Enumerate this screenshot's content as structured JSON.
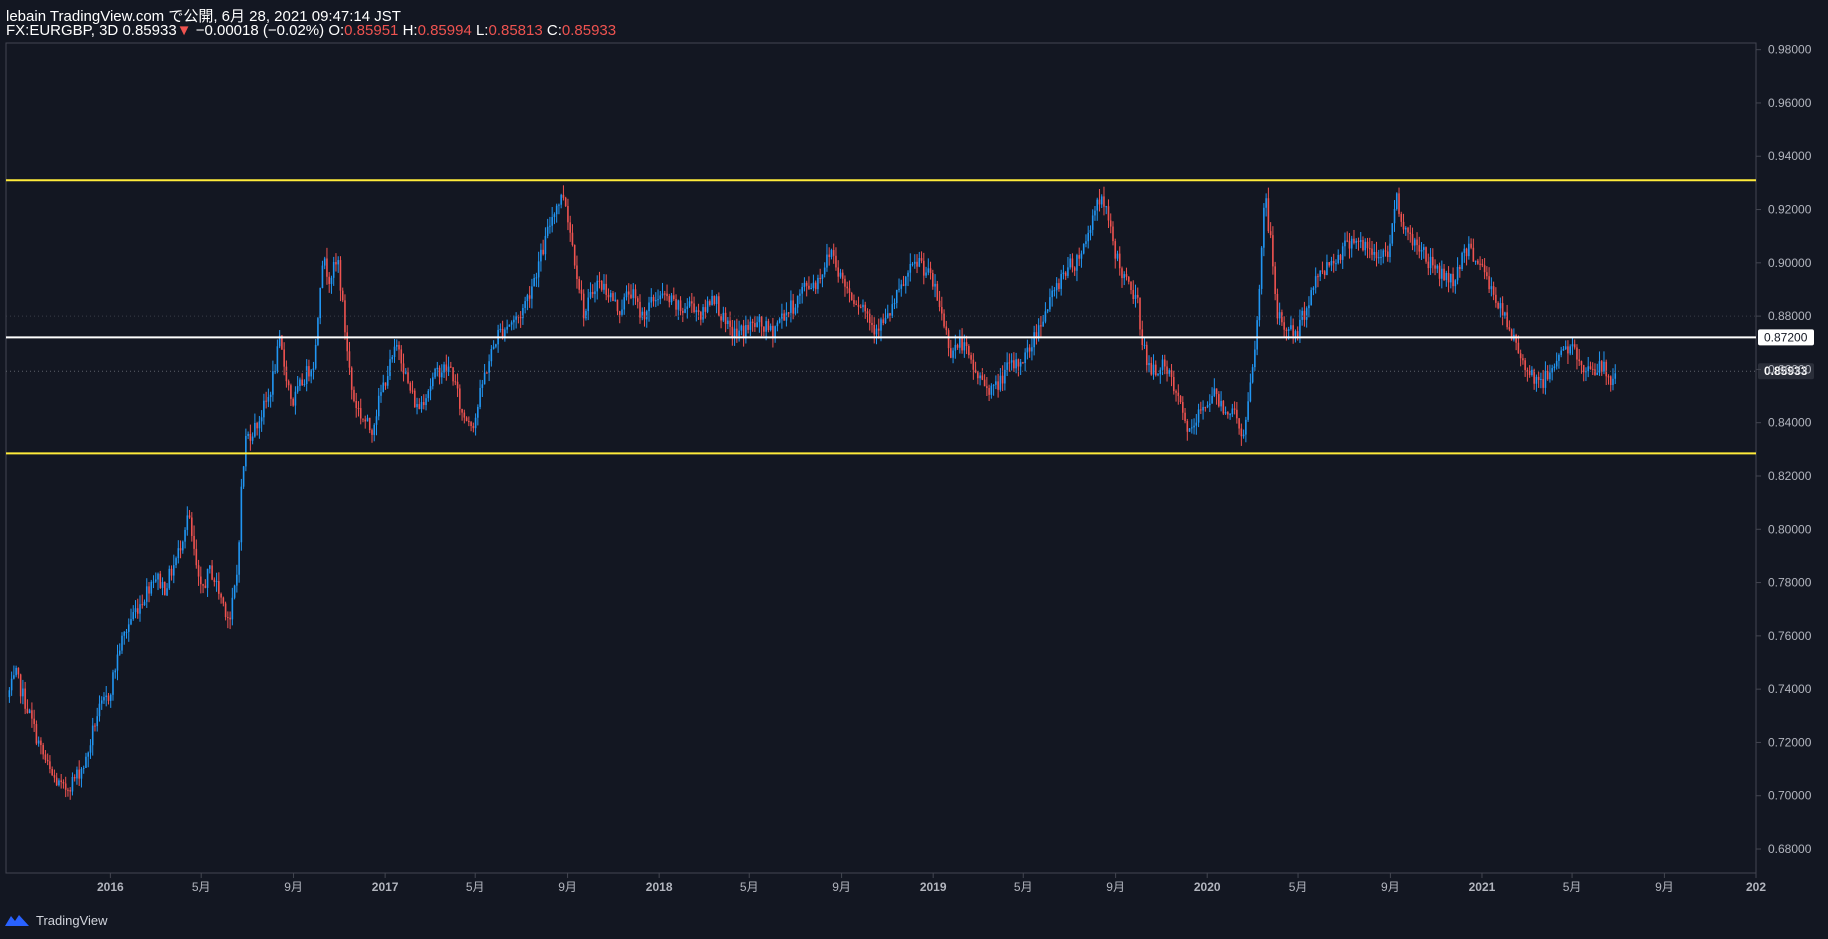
{
  "header": {
    "publisher_line": "lebain TradingView.com で公開, 6月 28, 2021 09:47:14 JST",
    "symbol": "FX:EURGBP, 3D",
    "last_price": "0.85933",
    "change_arrow": "▼",
    "change": "−0.00018 (−0.02%)",
    "open_label": "O:",
    "open": "0.85951",
    "high_label": "H:",
    "high": "0.85994",
    "low_label": "L:",
    "low": "0.85813",
    "close_label": "C:",
    "close": "0.85933"
  },
  "footer": {
    "brand": "TradingView",
    "logo_icon": "tradingview-logo-icon"
  },
  "colors": {
    "background": "#131722",
    "up": "#2196f3",
    "down": "#ef5350",
    "support_resistance": "#ffeb3b",
    "midline": "#ffffff",
    "axis_text": "#b2b5be",
    "grid": "#2a2e39"
  },
  "chart_data": {
    "type": "candlestick",
    "symbol": "FX:EURGBP",
    "interval": "3D",
    "title": "",
    "xlabel": "",
    "ylabel": "",
    "ylim": [
      0.671,
      0.9825
    ],
    "xlim": [
      "2015-08-15",
      "2022-01-01"
    ],
    "y_ticks": [
      "0.68000",
      "0.70000",
      "0.72000",
      "0.74000",
      "0.76000",
      "0.78000",
      "0.80000",
      "0.82000",
      "0.84000",
      "0.86000",
      "0.88000",
      "0.90000",
      "0.92000",
      "0.94000",
      "0.96000",
      "0.98000"
    ],
    "x_ticks": [
      {
        "date": "2016-01-01",
        "label": "2016",
        "bold": true
      },
      {
        "date": "2016-05-01",
        "label": "5月"
      },
      {
        "date": "2016-09-01",
        "label": "9月"
      },
      {
        "date": "2017-01-01",
        "label": "2017",
        "bold": true
      },
      {
        "date": "2017-05-01",
        "label": "5月"
      },
      {
        "date": "2017-09-01",
        "label": "9月"
      },
      {
        "date": "2018-01-01",
        "label": "2018",
        "bold": true
      },
      {
        "date": "2018-05-01",
        "label": "5月"
      },
      {
        "date": "2018-09-01",
        "label": "9月"
      },
      {
        "date": "2019-01-01",
        "label": "2019",
        "bold": true
      },
      {
        "date": "2019-05-01",
        "label": "5月"
      },
      {
        "date": "2019-09-01",
        "label": "9月"
      },
      {
        "date": "2020-01-01",
        "label": "2020",
        "bold": true
      },
      {
        "date": "2020-05-01",
        "label": "5月"
      },
      {
        "date": "2020-09-01",
        "label": "9月"
      },
      {
        "date": "2021-01-01",
        "label": "2021",
        "bold": true
      },
      {
        "date": "2021-05-01",
        "label": "5月"
      },
      {
        "date": "2021-09-01",
        "label": "9月"
      },
      {
        "date": "2022-01-01",
        "label": "202",
        "bold": true
      }
    ],
    "horizontal_lines": [
      {
        "name": "resistance",
        "value": 0.931,
        "color": "#ffeb3b"
      },
      {
        "name": "midline",
        "value": 0.872,
        "color": "#ffffff",
        "label": "0.87200"
      },
      {
        "name": "support",
        "value": 0.8285,
        "color": "#ffeb3b"
      }
    ],
    "price_label": {
      "value": 0.85933,
      "label": "0.85933"
    },
    "price_path": [
      [
        "2015-08-18",
        0.737
      ],
      [
        "2015-08-30",
        0.745
      ],
      [
        "2015-09-15",
        0.732
      ],
      [
        "2015-10-01",
        0.718
      ],
      [
        "2015-10-15",
        0.708
      ],
      [
        "2015-11-01",
        0.702
      ],
      [
        "2015-11-15",
        0.706
      ],
      [
        "2015-12-01",
        0.713
      ],
      [
        "2015-12-15",
        0.73
      ],
      [
        "2016-01-01",
        0.738
      ],
      [
        "2016-01-15",
        0.756
      ],
      [
        "2016-02-01",
        0.768
      ],
      [
        "2016-02-15",
        0.774
      ],
      [
        "2016-03-01",
        0.783
      ],
      [
        "2016-03-15",
        0.778
      ],
      [
        "2016-04-01",
        0.79
      ],
      [
        "2016-04-15",
        0.806
      ],
      [
        "2016-05-01",
        0.776
      ],
      [
        "2016-05-15",
        0.785
      ],
      [
        "2016-06-01",
        0.772
      ],
      [
        "2016-06-10",
        0.766
      ],
      [
        "2016-06-20",
        0.785
      ],
      [
        "2016-06-24",
        0.811
      ],
      [
        "2016-07-01",
        0.834
      ],
      [
        "2016-07-15",
        0.839
      ],
      [
        "2016-08-01",
        0.85
      ],
      [
        "2016-08-15",
        0.87
      ],
      [
        "2016-09-01",
        0.847
      ],
      [
        "2016-09-15",
        0.856
      ],
      [
        "2016-10-01",
        0.864
      ],
      [
        "2016-10-10",
        0.902
      ],
      [
        "2016-10-20",
        0.895
      ],
      [
        "2016-11-01",
        0.9
      ],
      [
        "2016-11-10",
        0.875
      ],
      [
        "2016-11-20",
        0.85
      ],
      [
        "2016-12-01",
        0.843
      ],
      [
        "2016-12-15",
        0.837
      ],
      [
        "2017-01-01",
        0.855
      ],
      [
        "2017-01-20",
        0.87
      ],
      [
        "2017-02-01",
        0.855
      ],
      [
        "2017-02-15",
        0.845
      ],
      [
        "2017-03-01",
        0.853
      ],
      [
        "2017-03-15",
        0.86
      ],
      [
        "2017-04-01",
        0.86
      ],
      [
        "2017-04-15",
        0.843
      ],
      [
        "2017-05-01",
        0.84
      ],
      [
        "2017-05-15",
        0.858
      ],
      [
        "2017-06-01",
        0.873
      ],
      [
        "2017-06-15",
        0.877
      ],
      [
        "2017-07-01",
        0.88
      ],
      [
        "2017-07-15",
        0.89
      ],
      [
        "2017-08-01",
        0.905
      ],
      [
        "2017-08-15",
        0.92
      ],
      [
        "2017-08-29",
        0.926
      ],
      [
        "2017-09-10",
        0.905
      ],
      [
        "2017-09-25",
        0.88
      ],
      [
        "2017-10-10",
        0.893
      ],
      [
        "2017-10-25",
        0.89
      ],
      [
        "2017-11-10",
        0.882
      ],
      [
        "2017-11-25",
        0.89
      ],
      [
        "2017-12-10",
        0.88
      ],
      [
        "2018-01-01",
        0.888
      ],
      [
        "2018-01-15",
        0.886
      ],
      [
        "2018-02-01",
        0.882
      ],
      [
        "2018-02-15",
        0.885
      ],
      [
        "2018-03-01",
        0.88
      ],
      [
        "2018-03-15",
        0.889
      ],
      [
        "2018-04-01",
        0.876
      ],
      [
        "2018-04-15",
        0.873
      ],
      [
        "2018-05-01",
        0.876
      ],
      [
        "2018-05-15",
        0.877
      ],
      [
        "2018-06-01",
        0.874
      ],
      [
        "2018-06-15",
        0.88
      ],
      [
        "2018-07-01",
        0.884
      ],
      [
        "2018-07-15",
        0.891
      ],
      [
        "2018-08-01",
        0.893
      ],
      [
        "2018-08-20",
        0.905
      ],
      [
        "2018-09-01",
        0.895
      ],
      [
        "2018-09-15",
        0.888
      ],
      [
        "2018-10-01",
        0.884
      ],
      [
        "2018-10-15",
        0.876
      ],
      [
        "2018-11-01",
        0.878
      ],
      [
        "2018-11-15",
        0.887
      ],
      [
        "2018-12-01",
        0.896
      ],
      [
        "2018-12-15",
        0.901
      ],
      [
        "2019-01-01",
        0.893
      ],
      [
        "2019-01-15",
        0.88
      ],
      [
        "2019-01-25",
        0.867
      ],
      [
        "2019-02-10",
        0.87
      ],
      [
        "2019-02-25",
        0.86
      ],
      [
        "2019-03-10",
        0.855
      ],
      [
        "2019-03-25",
        0.852
      ],
      [
        "2019-04-10",
        0.86
      ],
      [
        "2019-04-25",
        0.862
      ],
      [
        "2019-05-10",
        0.867
      ],
      [
        "2019-05-25",
        0.878
      ],
      [
        "2019-06-10",
        0.887
      ],
      [
        "2019-06-25",
        0.897
      ],
      [
        "2019-07-10",
        0.9
      ],
      [
        "2019-07-25",
        0.908
      ],
      [
        "2019-08-10",
        0.925
      ],
      [
        "2019-08-20",
        0.92
      ],
      [
        "2019-09-01",
        0.905
      ],
      [
        "2019-09-15",
        0.893
      ],
      [
        "2019-10-01",
        0.886
      ],
      [
        "2019-10-10",
        0.868
      ],
      [
        "2019-10-20",
        0.858
      ],
      [
        "2019-11-01",
        0.862
      ],
      [
        "2019-11-15",
        0.856
      ],
      [
        "2019-12-01",
        0.843
      ],
      [
        "2019-12-12",
        0.835
      ],
      [
        "2019-12-25",
        0.845
      ],
      [
        "2020-01-10",
        0.851
      ],
      [
        "2020-01-25",
        0.846
      ],
      [
        "2020-02-10",
        0.843
      ],
      [
        "2020-02-20",
        0.834
      ],
      [
        "2020-03-01",
        0.855
      ],
      [
        "2020-03-10",
        0.88
      ],
      [
        "2020-03-19",
        0.927
      ],
      [
        "2020-03-28",
        0.905
      ],
      [
        "2020-04-05",
        0.88
      ],
      [
        "2020-04-15",
        0.876
      ],
      [
        "2020-05-01",
        0.873
      ],
      [
        "2020-05-15",
        0.885
      ],
      [
        "2020-06-01",
        0.897
      ],
      [
        "2020-06-15",
        0.9
      ],
      [
        "2020-07-01",
        0.905
      ],
      [
        "2020-07-15",
        0.91
      ],
      [
        "2020-08-01",
        0.905
      ],
      [
        "2020-08-15",
        0.902
      ],
      [
        "2020-09-01",
        0.905
      ],
      [
        "2020-09-10",
        0.925
      ],
      [
        "2020-09-25",
        0.91
      ],
      [
        "2020-10-10",
        0.907
      ],
      [
        "2020-10-25",
        0.9
      ],
      [
        "2020-11-10",
        0.896
      ],
      [
        "2020-11-25",
        0.893
      ],
      [
        "2020-12-10",
        0.905
      ],
      [
        "2020-12-25",
        0.903
      ],
      [
        "2021-01-10",
        0.893
      ],
      [
        "2021-01-25",
        0.884
      ],
      [
        "2021-02-10",
        0.873
      ],
      [
        "2021-02-25",
        0.864
      ],
      [
        "2021-03-10",
        0.858
      ],
      [
        "2021-03-25",
        0.855
      ],
      [
        "2021-04-05",
        0.86
      ],
      [
        "2021-04-15",
        0.867
      ],
      [
        "2021-05-01",
        0.868
      ],
      [
        "2021-05-15",
        0.861
      ],
      [
        "2021-06-01",
        0.861
      ],
      [
        "2021-06-15",
        0.86
      ],
      [
        "2021-06-22",
        0.856
      ],
      [
        "2021-06-28",
        0.85933
      ]
    ]
  }
}
